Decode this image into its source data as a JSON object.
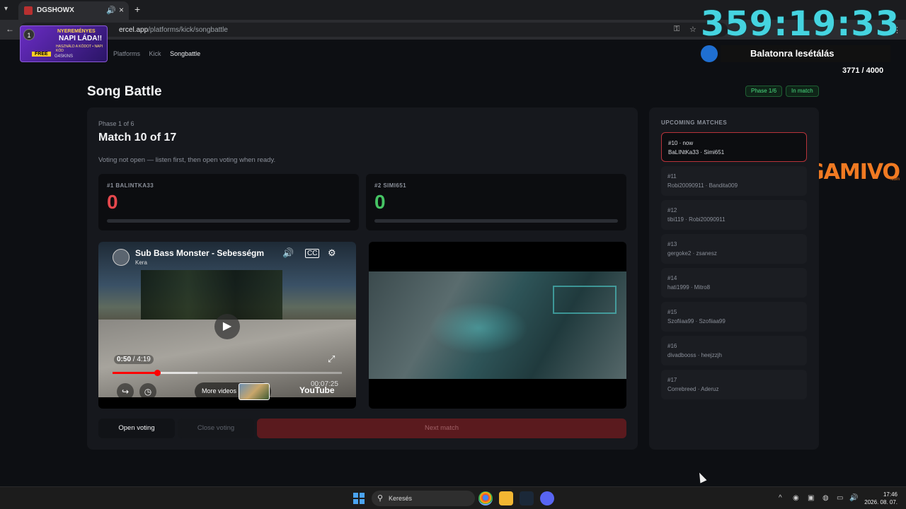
{
  "browser": {
    "tab_title": "DGSHOWX",
    "url_prefix": "ercel.app",
    "url_path": "/platforms/kick/songbattle"
  },
  "promo": {
    "badge": "1",
    "line1": "NYEREMÉNYES",
    "line2": "NAPI LÁDA!!",
    "line3": "HASZNÁLD A KÓDOT • NAPI KÓD",
    "free": "FREE",
    "brand": "G4SKINS"
  },
  "nav": {
    "breadcrumbs": [
      "Platforms",
      "Kick",
      "Songbattle"
    ]
  },
  "overlay": {
    "timer": "359:19:33",
    "goal_title": "Balatonra lesétálás",
    "goal_count": "3771 / 4000",
    "sponsor": "GAMIVO",
    "sponsor_sub": ".com"
  },
  "page": {
    "title": "Song Battle",
    "pill_phase": "Phase 1/6",
    "pill_status": "In match"
  },
  "match": {
    "phase_label": "Phase 1 of 6",
    "title": "Match 10 of 17",
    "vote_note": "Voting not open — listen first, then open voting when ready.",
    "left": {
      "label": "#1 BALINTKA33",
      "score": "0",
      "color": "#e5484d",
      "progress": 0
    },
    "right": {
      "label": "#2 SIMI651",
      "score": "0",
      "color": "#46c464",
      "progress": 0
    }
  },
  "video": {
    "title": "Sub Bass Monster - Sebességm",
    "channel": "Kera",
    "time_current": "0:50",
    "time_total": "4:19",
    "progress": 0.193,
    "buffered": 0.37,
    "more_videos": "More videos",
    "logo": "YouTube",
    "stamp": "00:07:25"
  },
  "buttons": {
    "open_voting": "Open voting",
    "close_voting": "Close voting",
    "next_match": "Next match"
  },
  "upcoming": {
    "heading": "UPCOMING MATCHES",
    "items": [
      {
        "num": "#10 · now",
        "players": "BaLINtKa33 · Simi651"
      },
      {
        "num": "#11",
        "players": "Robi20090911 · Bandita009"
      },
      {
        "num": "#12",
        "players": "tibi119 · Robi20090911"
      },
      {
        "num": "#13",
        "players": "gergoke2 · zsanesz"
      },
      {
        "num": "#14",
        "players": "hati1999 · Mitro8"
      },
      {
        "num": "#15",
        "players": "Szofiiaa99 · Szofiiaa99"
      },
      {
        "num": "#16",
        "players": "divadbooss · heejzzjh"
      },
      {
        "num": "#17",
        "players": "Correbreed · Aderuz"
      }
    ]
  },
  "taskbar": {
    "search_label": "Keresés",
    "time": "17:46",
    "date": "2026. 08. 07."
  }
}
